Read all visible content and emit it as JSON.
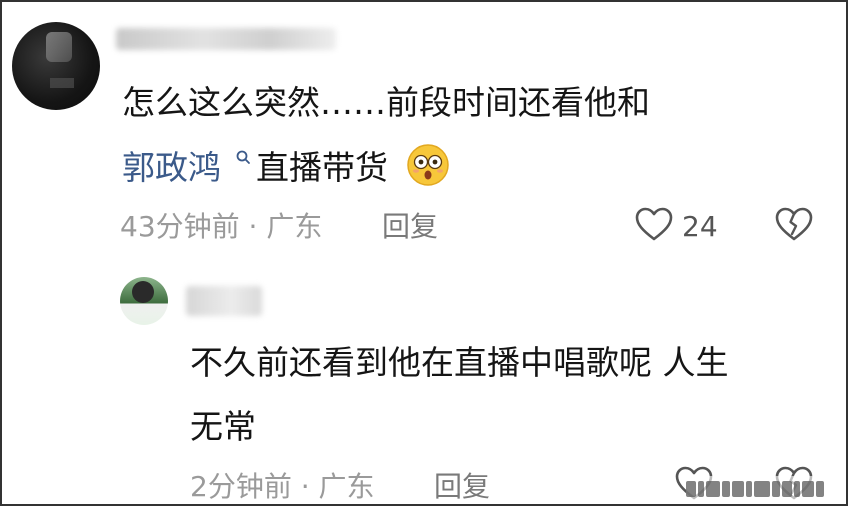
{
  "comment": {
    "line1": "怎么这么突然……前段时间还看他和",
    "mention": "郭政鸿",
    "line2_rest": "直播带货",
    "emoji": "flushed-face-icon",
    "time_location": "43分钟前 · 广东",
    "reply_label": "回复",
    "likes": "24"
  },
  "reply": {
    "line1": "不久前还看到他在直播中唱歌呢 人生",
    "line2": "无常",
    "time_location": "2分钟前 · 广东",
    "reply_label": "回复"
  },
  "colors": {
    "mention": "#3b5a8a",
    "meta_text": "#9a9a9a",
    "icon_stroke": "#555555"
  }
}
